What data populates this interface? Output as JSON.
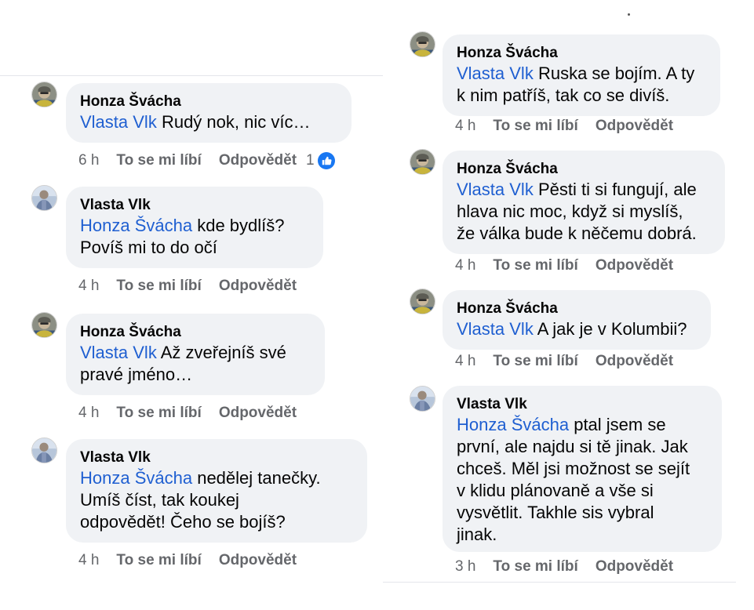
{
  "left_column": [
    {
      "author": "Honza Švácha",
      "mention": "Vlasta Vlk",
      "lines": [
        " Rudý nok, nic víc…"
      ],
      "time": "6 h",
      "like": "To se mi líbí",
      "reply": "Odpovědět",
      "reaction_count": "1",
      "avatar": "honza"
    },
    {
      "author": "Vlasta Vlk",
      "mention": "Honza Švácha",
      "lines": [
        " kde bydlíš?",
        "Povíš mi to do očí"
      ],
      "time": "4 h",
      "like": "To se mi líbí",
      "reply": "Odpovědět",
      "avatar": "vlasta"
    },
    {
      "author": "Honza Švácha",
      "mention": "Vlasta Vlk",
      "lines": [
        " Až zveřejníš své",
        "pravé jméno…"
      ],
      "time": "4 h",
      "like": "To se mi líbí",
      "reply": "Odpovědět",
      "avatar": "honza"
    },
    {
      "author": "Vlasta Vlk",
      "mention": "Honza Švácha",
      "lines": [
        " nedělej tanečky.",
        "Umíš číst, tak koukej",
        "odpovědět! Čeho se bojíš?"
      ],
      "time": "4 h",
      "like": "To se mi líbí",
      "reply": "Odpovědět",
      "avatar": "vlasta"
    }
  ],
  "right_column": [
    {
      "author": "Honza Švácha",
      "mention": "Vlasta Vlk",
      "lines": [
        " Ruska se bojím. A ty",
        "k nim patříš, tak co se divíš."
      ],
      "time": "4 h",
      "like": "To se mi líbí",
      "reply": "Odpovědět",
      "avatar": "honza"
    },
    {
      "author": "Honza Švácha",
      "mention": "Vlasta Vlk",
      "lines": [
        " Pěsti ti si fungují, ale",
        "hlava nic moc, když si myslíš,",
        "že válka bude k něčemu dobrá."
      ],
      "time": "4 h",
      "like": "To se mi líbí",
      "reply": "Odpovědět",
      "avatar": "honza"
    },
    {
      "author": "Honza Švácha",
      "mention": "Vlasta Vlk",
      "lines": [
        " A jak je v Kolumbii?"
      ],
      "time": "4 h",
      "like": "To se mi líbí",
      "reply": "Odpovědět",
      "avatar": "honza"
    },
    {
      "author": "Vlasta Vlk",
      "mention": "Honza Švácha",
      "lines": [
        " ptal jsem se",
        "první,  ale najdu si tě jinak. Jak",
        "chceš.  Měl jsi možnost se sejít",
        "v klidu plánovaně a vše si",
        "vysvětlit. Takhle sis vybral",
        "jinak."
      ],
      "time": "3 h",
      "like": "To se mi líbí",
      "reply": "Odpovědět",
      "avatar": "vlasta"
    }
  ],
  "colors": {
    "bubble": "#f0f2f5",
    "mention": "#1f5fd1",
    "meta": "#65676b",
    "like_badge": "#1877f2"
  }
}
